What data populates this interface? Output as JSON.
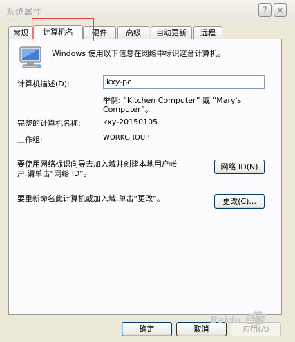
{
  "window": {
    "title": "系统属性",
    "help_icon": "?",
    "close_icon": "×"
  },
  "tabs": [
    {
      "label": "常规",
      "active": false
    },
    {
      "label": "计算机名",
      "active": true
    },
    {
      "label": "硬件",
      "active": false
    },
    {
      "label": "高级",
      "active": false
    },
    {
      "label": "自动更新",
      "active": false
    },
    {
      "label": "远程",
      "active": false
    }
  ],
  "panel": {
    "intro_text": "Windows 使用以下信息在网络中标识这台计算机。",
    "description_label": "计算机描述(D):",
    "description_value": "kxy-pc",
    "example_line1": "举例: “Kitchen Computer” 或 “Mary's",
    "example_line2": "Computer”。",
    "full_name_label": "完整的计算机名称:",
    "full_name_value": "kxy-20150105.",
    "workgroup_label": "工作组:",
    "workgroup_value": "WORKGROUP",
    "network_text_line1": "要使用网络标识向导去加入域并创建本地用户帐",
    "network_text_line2": "户,请单击“网络 ID”。",
    "network_id_button": "网络 ID(N)",
    "rename_text": "要重新命名此计算机或加入域,单击“更改”。",
    "change_button": "更改(C)..."
  },
  "footer": {
    "ok_button": "确定",
    "cancel_button": "取消",
    "apply_button": "应用(A)"
  },
  "watermark": {
    "text": "Baidu 经验"
  }
}
